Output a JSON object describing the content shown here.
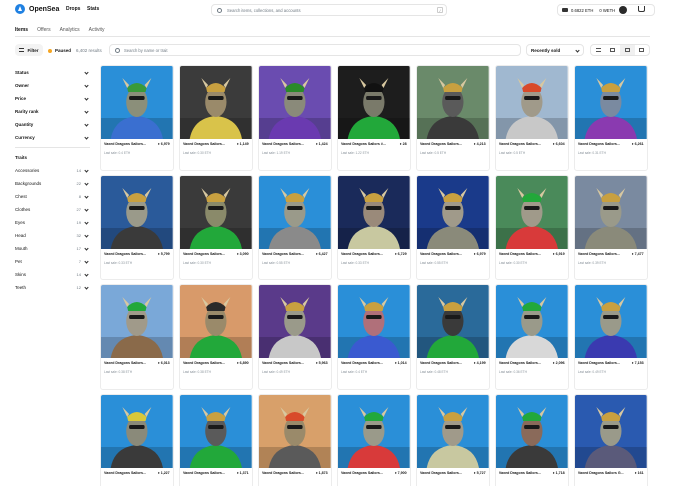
{
  "brand": {
    "name": "OpenSea"
  },
  "nav": {
    "drops": "Drops",
    "stats": "Stats"
  },
  "search": {
    "placeholder": "Search items, collections, and accounts",
    "shortcut": "/"
  },
  "wallet": {
    "eth_balance": "0.6822 ETH",
    "weth_balance": "0 WETH"
  },
  "tabs": [
    "Items",
    "Offers",
    "Analytics",
    "Activity"
  ],
  "toolbar": {
    "filter_label": "Filter",
    "status_label": "Paused",
    "results": "6,402 results",
    "search_placeholder": "Search by name or trait",
    "sort_value": "Recently sold"
  },
  "sidebar": {
    "sections": [
      "Status",
      "Owner",
      "Price",
      "Rarity rank",
      "Quantity",
      "Currency"
    ],
    "traits_title": "Traits",
    "traits": [
      {
        "name": "Accessories",
        "count": "14"
      },
      {
        "name": "Backgrounds",
        "count": "22"
      },
      {
        "name": "Chest",
        "count": "8"
      },
      {
        "name": "Clothes",
        "count": "27"
      },
      {
        "name": "Eyes",
        "count": "19"
      },
      {
        "name": "Head",
        "count": "32"
      },
      {
        "name": "Mouth",
        "count": "17"
      },
      {
        "name": "Pet",
        "count": "7"
      },
      {
        "name": "Skins",
        "count": "14"
      },
      {
        "name": "Teeth",
        "count": "12"
      }
    ]
  },
  "cards": [
    {
      "name": "Vaxed Dragons Sailors...",
      "rank": "♦ 6,979",
      "last_sale": "Last sale: 0.4 ETH",
      "bg": "#2a8fd8",
      "skin": "#8b8f7a",
      "outfit": "#3a6fd0",
      "hat": "#3a9a3a"
    },
    {
      "name": "Vaxed Dragons Sailors...",
      "rank": "♦ 1,149",
      "last_sale": "Last sale: 0.30 ETH",
      "bg": "#3b3b3b",
      "skin": "#9a8a6a",
      "outfit": "#d9c34a",
      "hat": "#c8a040"
    },
    {
      "name": "Vaxed Dragons Sailors...",
      "rank": "♦ 1,424",
      "last_sale": "Last sale: 1.19 ETH",
      "bg": "#6a4cb0",
      "skin": "#8a8a7a",
      "outfit": "#6a3ab0",
      "hat": "#2a8a2a"
    },
    {
      "name": "Vaxed Dragons Sailors #...",
      "rank": "♦ 28",
      "last_sale": "Last sale: 1.22 ETH",
      "bg": "#1d1d1d",
      "skin": "#7a7a6a",
      "outfit": "#22a83a",
      "hat": "#111111"
    },
    {
      "name": "Vaxed Dragons Sailors...",
      "rank": "♦ 4,213",
      "last_sale": "Last sale: 0.5 ETH",
      "bg": "#6a8a6a",
      "skin": "#5a5a5a",
      "outfit": "#3a3a3a",
      "hat": "#c8a040"
    },
    {
      "name": "Vaxed Dragons Sailors...",
      "rank": "♦ 6,604",
      "last_sale": "Last sale: 0.5 ETH",
      "bg": "#a0b8d0",
      "skin": "#a09a8a",
      "outfit": "#c8c8c8",
      "hat": "#d84a2a"
    },
    {
      "name": "Vaxed Dragons Sailors...",
      "rank": "♦ 6,261",
      "last_sale": "Last sale: 0.31 ETH",
      "bg": "#2a8fd8",
      "skin": "#7a8aa0",
      "outfit": "#8a3ab0",
      "hat": "#c8a040"
    },
    {
      "name": "Vaxed Dragons Sailors...",
      "rank": "♦ 5,799",
      "last_sale": "Last sale: 0.33 ETH",
      "bg": "#2a5a9a",
      "skin": "#9a9a8a",
      "outfit": "#3a3a3a",
      "hat": "#c8a040"
    },
    {
      "name": "Vaxed Dragons Sailors...",
      "rank": "♦ 3,090",
      "last_sale": "Last sale: 0.30 ETH",
      "bg": "#3a3a3a",
      "skin": "#8a8a6a",
      "outfit": "#22a83a",
      "hat": "#c8a040"
    },
    {
      "name": "Vaxed Dragons Sailors...",
      "rank": "♦ 6,427",
      "last_sale": "Last sale: 0.55 ETH",
      "bg": "#2a8fd8",
      "skin": "#9a9a8a",
      "outfit": "#8a8a8a",
      "hat": "#c8a040"
    },
    {
      "name": "Vaxed Dragons Sailors...",
      "rank": "♦ 6,729",
      "last_sale": "Last sale: 0.33 ETH",
      "bg": "#1a2a5a",
      "skin": "#9a8a7a",
      "outfit": "#c8c8a0",
      "hat": "#c8a040"
    },
    {
      "name": "Vaxed Dragons Sailors...",
      "rank": "♦ 6,979",
      "last_sale": "Last sale: 0.55 ETH",
      "bg": "#1a3a8a",
      "skin": "#a09a8a",
      "outfit": "#8a8a7a",
      "hat": "#c8a040"
    },
    {
      "name": "Vaxed Dragons Sailors...",
      "rank": "♦ 6,919",
      "last_sale": "Last sale: 0.30 ETH",
      "bg": "#4a8a5a",
      "skin": "#a09a8a",
      "outfit": "#d83a3a",
      "hat": "#22a83a"
    },
    {
      "name": "Vaxed Dragons Sailors...",
      "rank": "♦ 7,477",
      "last_sale": "Last sale: 0.39 ETH",
      "bg": "#7a8aa0",
      "skin": "#9a9a8a",
      "outfit": "#8a8a7a",
      "hat": "#c8a040"
    },
    {
      "name": "Vaxed Dragons Sailors...",
      "rank": "♦ 6,013",
      "last_sale": "Last sale: 0.38 ETH",
      "bg": "#7aa8d8",
      "skin": "#a09a8a",
      "outfit": "#8a6a4a",
      "hat": "#22a83a"
    },
    {
      "name": "Vaxed Dragons Sailors...",
      "rank": "♦ 6,890",
      "last_sale": "Last sale: 0.38 ETH",
      "bg": "#d89a6a",
      "skin": "#9a8a6a",
      "outfit": "#22a83a",
      "hat": "#2a2a2a"
    },
    {
      "name": "Vaxed Dragons Sailors...",
      "rank": "♦ 5,963",
      "last_sale": "Last sale: 0.49 ETH",
      "bg": "#5a3a8a",
      "skin": "#9a9a8a",
      "outfit": "#c8c8c8",
      "hat": "#c8a040"
    },
    {
      "name": "Vaxed Dragons Sailors...",
      "rank": "♦ 1,014",
      "last_sale": "Last sale: 0.4 ETH",
      "bg": "#2a8fd8",
      "skin": "#b0707a",
      "outfit": "#3a5ad0",
      "hat": "#c8a040"
    },
    {
      "name": "Vaxed Dragons Sailors...",
      "rank": "♦ 4,199",
      "last_sale": "Last sale: 0.48 ETH",
      "bg": "#2a6a9a",
      "skin": "#3a3a3a",
      "outfit": "#22a83a",
      "hat": "#c8a040"
    },
    {
      "name": "Vaxed Dragons Sailors...",
      "rank": "♦ 2,096",
      "last_sale": "Last sale: 0.36 ETH",
      "bg": "#2a8fd8",
      "skin": "#9a9a8a",
      "outfit": "#d8d8d8",
      "hat": "#22a83a"
    },
    {
      "name": "Vaxed Dragons Sailors...",
      "rank": "♦ 7,153",
      "last_sale": "Last sale: 0.49 ETH",
      "bg": "#2a8fd8",
      "skin": "#9a9a8a",
      "outfit": "#3a3ab0",
      "hat": "#c8a040"
    },
    {
      "name": "Vaxed Dragons Sailors...",
      "rank": "♦ 1,227",
      "last_sale": "",
      "bg": "#2a8fd8",
      "skin": "#8a8a7a",
      "outfit": "#3a3a3a",
      "hat": "#d8c83a"
    },
    {
      "name": "Vaxed Dragons Sailors...",
      "rank": "♦ 1,371",
      "last_sale": "",
      "bg": "#2a8fd8",
      "skin": "#5a5a5a",
      "outfit": "#22a83a",
      "hat": "#c8a040"
    },
    {
      "name": "Vaxed Dragons Sailors...",
      "rank": "♦ 1,873",
      "last_sale": "",
      "bg": "#d8a06a",
      "skin": "#9a8a6a",
      "outfit": "#5a5a5a",
      "hat": "#d84a2a"
    },
    {
      "name": "Vaxed Dragons Sailors...",
      "rank": "♦ 7,900",
      "last_sale": "",
      "bg": "#2a8fd8",
      "skin": "#9a9a8a",
      "outfit": "#d83a3a",
      "hat": "#22a83a"
    },
    {
      "name": "Vaxed Dragons Sailors...",
      "rank": "♦ 5,727",
      "last_sale": "",
      "bg": "#2a8fd8",
      "skin": "#a09a8a",
      "outfit": "#c8c8a0",
      "hat": "#c8a040"
    },
    {
      "name": "Vaxed Dragons Sailors...",
      "rank": "♦ 1,718",
      "last_sale": "",
      "bg": "#2a8fd8",
      "skin": "#8a6a5a",
      "outfit": "#3a3a3a",
      "hat": "#22a83a"
    },
    {
      "name": "Vaxed Dragons Sailors G...",
      "rank": "♦ 161",
      "last_sale": "",
      "bg": "#2a5ab0",
      "skin": "#9a9a8a",
      "outfit": "#5a5a7a",
      "hat": "#c8a040"
    }
  ]
}
